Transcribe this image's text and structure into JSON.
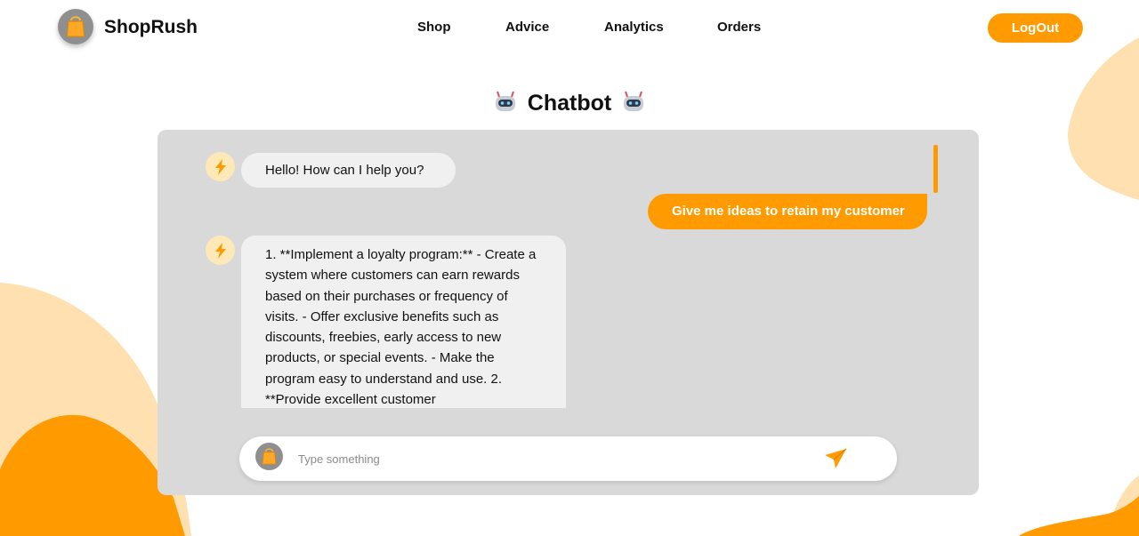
{
  "header": {
    "brand": "ShopRush",
    "nav": [
      "Shop",
      "Advice",
      "Analytics",
      "Orders"
    ],
    "logout_label": "LogOut"
  },
  "chat": {
    "title": "Chatbot",
    "messages": [
      {
        "from": "bot",
        "text": "Hello! How can I help you?"
      },
      {
        "from": "user",
        "text": "Give me ideas to retain my customer"
      },
      {
        "from": "bot",
        "text": "1. **Implement a loyalty program:** - Create a system where customers can earn rewards based on their purchases or frequency of visits. - Offer exclusive benefits such as discounts, freebies, early access to new products, or special events. - Make the program easy to understand and use. 2. **Provide excellent customer"
      }
    ],
    "input": {
      "placeholder": "Type something",
      "value": ""
    }
  },
  "icons": {
    "logo": "shopping-bag-icon",
    "title_decor": "robot-icon",
    "bot_avatar": "lightning-icon",
    "send": "send-icon"
  },
  "colors": {
    "accent": "#ff9a00",
    "panel": "#d9d9d9",
    "bot_bubble": "#f0f0f0",
    "avatar_bg": "#fde9b8",
    "blob_light": "#ffe0b0"
  }
}
